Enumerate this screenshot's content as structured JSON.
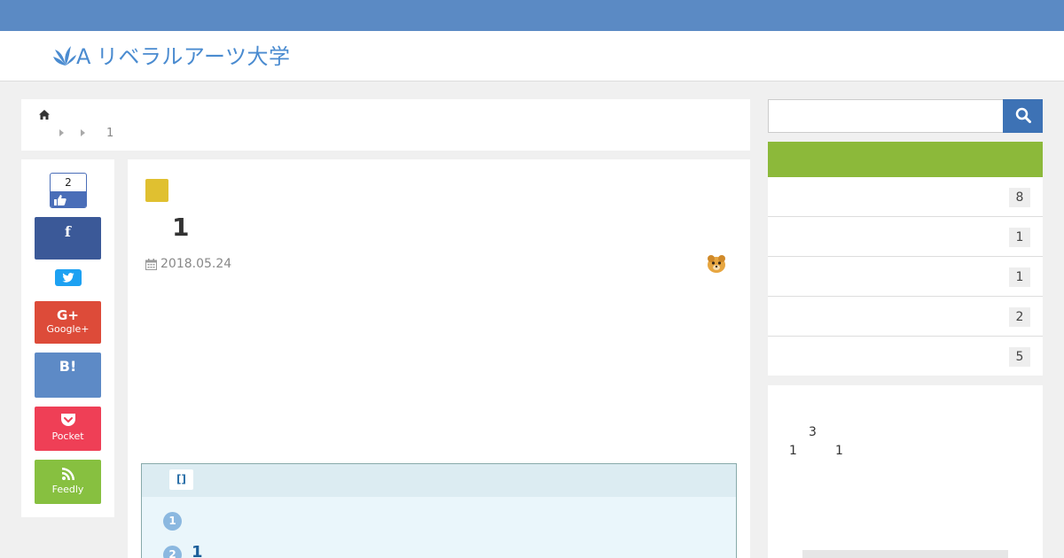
{
  "header": {
    "site_name": "リベラルアーツ大学",
    "logo_letter": "A"
  },
  "breadcrumb": {
    "current": "1"
  },
  "share": {
    "like_count": "2",
    "google_label": "Google+",
    "hatena_label": "B!",
    "pocket_label": "Pocket",
    "feedly_label": "Feedly",
    "google_icon": "G+"
  },
  "article": {
    "title": "1",
    "date": "2018.05.24",
    "category_color": "#e0c030"
  },
  "toc": {
    "toggle_label": "[]",
    "items": [
      {
        "num": "1",
        "text": ""
      },
      {
        "num": "2",
        "text": "1"
      }
    ]
  },
  "search": {
    "placeholder": ""
  },
  "categories": {
    "header_color": "#8cb93a",
    "counts": [
      "8",
      "1",
      "1",
      "2",
      "5"
    ]
  },
  "profile": {
    "line1": "3",
    "line2a": "1",
    "line2b": "1"
  },
  "colors": {
    "topbar": "#5b8ac4",
    "accent": "#4a8bd0",
    "search_button": "#3d72b5"
  }
}
